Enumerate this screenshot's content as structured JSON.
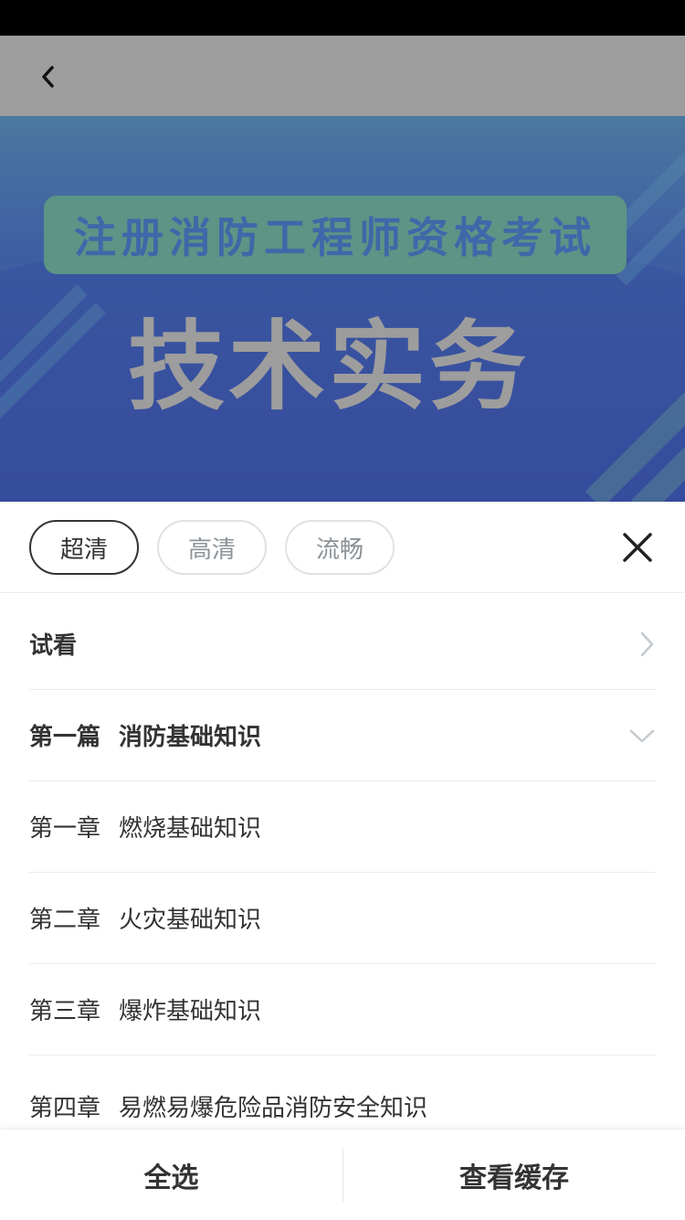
{
  "banner": {
    "subtitle": "注册消防工程师资格考试",
    "title": "技术实务"
  },
  "quality": {
    "options": [
      {
        "label": "超清",
        "active": true
      },
      {
        "label": "高清",
        "active": false
      },
      {
        "label": "流畅",
        "active": false
      }
    ]
  },
  "list": {
    "trial": "试看",
    "part1": {
      "prefix": "第一篇",
      "name": "消防基础知识"
    },
    "chapters": [
      {
        "prefix": "第一章",
        "name": "燃烧基础知识"
      },
      {
        "prefix": "第二章",
        "name": "火灾基础知识"
      },
      {
        "prefix": "第三章",
        "name": "爆炸基础知识"
      },
      {
        "prefix": "第四章",
        "name": "易燃易爆危险品消防安全知识"
      }
    ]
  },
  "bottom": {
    "select_all": "全选",
    "view_cache": "查看缓存"
  },
  "icons": {
    "back": "chevron-left-icon",
    "close": "close-icon",
    "trial_arrow": "chevron-right-icon",
    "part_arrow": "chevron-down-icon"
  },
  "colors": {
    "active_border": "#333333",
    "inactive_border": "#dde2e6",
    "inactive_text": "#8c9398"
  }
}
